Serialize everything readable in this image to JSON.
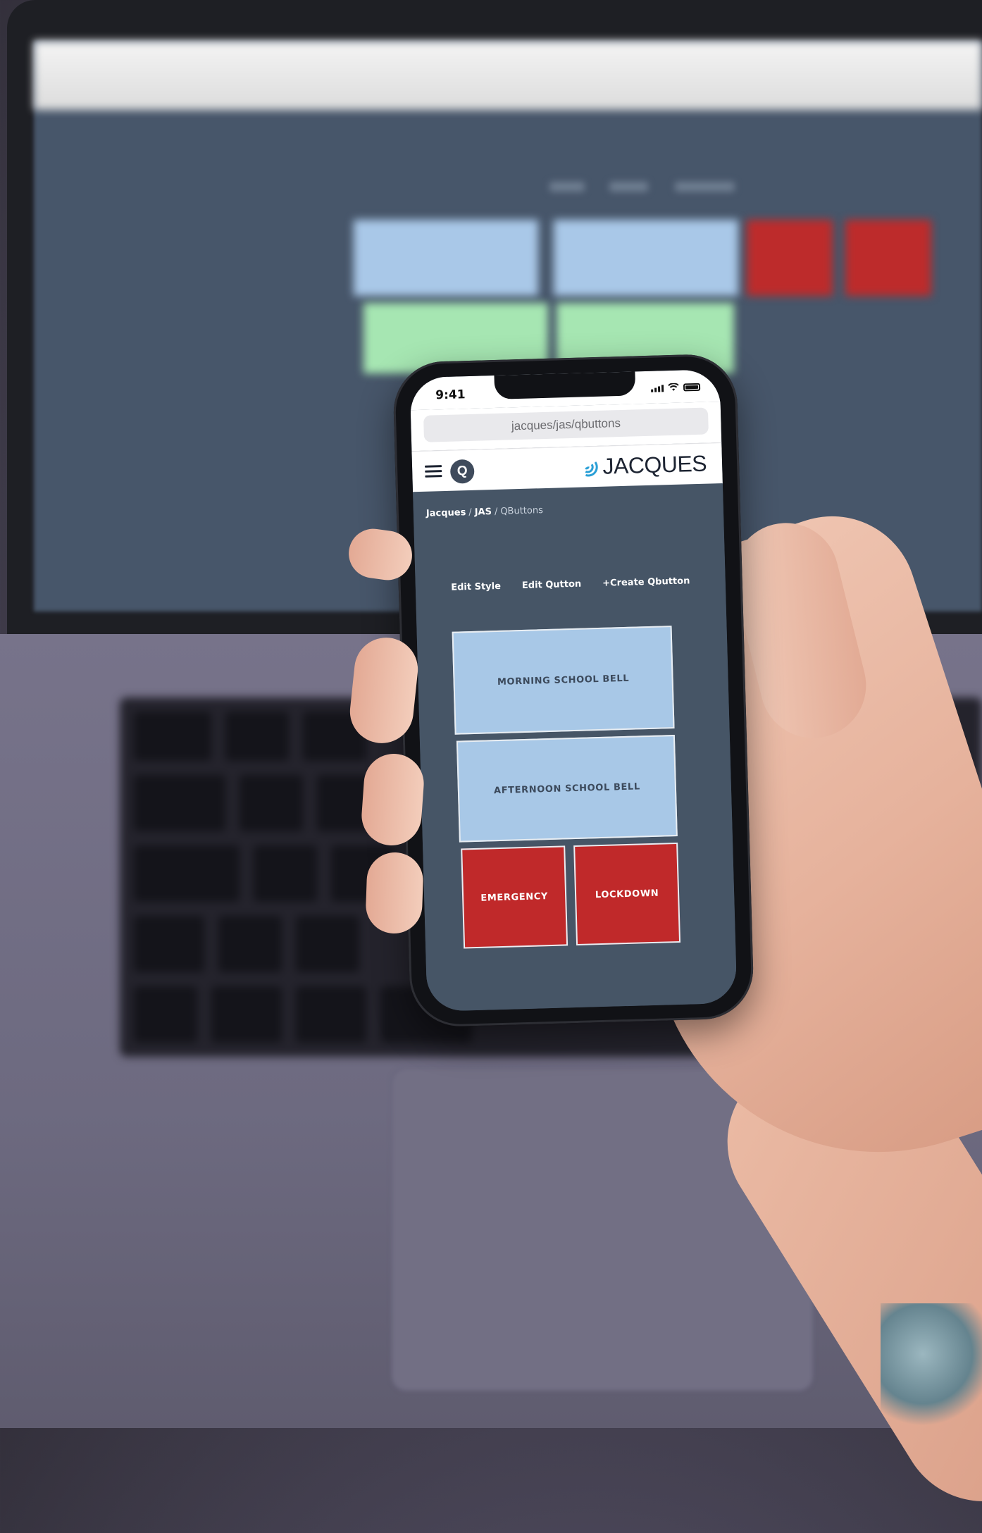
{
  "status_bar": {
    "time": "9:41"
  },
  "browser": {
    "url": "jacques/jas/qbuttons"
  },
  "header": {
    "logo_letter": "Q",
    "brand_name": "JACQUES"
  },
  "breadcrumb": {
    "items": [
      "Jacques",
      "JAS",
      "QButtons"
    ],
    "separator": "/"
  },
  "actions": {
    "edit_style": "Edit Style",
    "edit_qutton": "Edit Qutton",
    "create_qbutton": "+Create Qbutton"
  },
  "qbuttons": [
    {
      "label": "MORNING SCHOOL BELL",
      "color": "#a8c8e7"
    },
    {
      "label": "AFTERNOON SCHOOL BELL",
      "color": "#a8c8e7"
    },
    {
      "label": "EMERGENCY",
      "color": "#c0292a"
    },
    {
      "label": "LOCKDOWN",
      "color": "#c0292a"
    }
  ],
  "colors": {
    "app_background": "#465566",
    "brand_accent": "#2a9fd6",
    "header_background": "#ffffff"
  },
  "icons": [
    "menu-icon",
    "q-logo-icon",
    "jacques-logo-icon",
    "signal-icon",
    "wifi-icon",
    "battery-icon"
  ]
}
